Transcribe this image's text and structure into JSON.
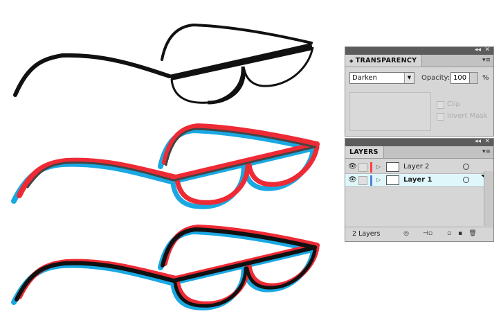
{
  "transparency_panel": {
    "title": "TRANSPARENCY",
    "blend_mode": "Darken",
    "opacity_label": "Opacity:",
    "opacity_value": "100",
    "opacity_unit": "%",
    "clip_label": "Clip",
    "invert_mask_label": "Invert Mask"
  },
  "layers_panel": {
    "title": "LAYERS",
    "layers": [
      {
        "name": "Layer 2",
        "color": "#ff4040",
        "selected": false
      },
      {
        "name": "Layer 1",
        "color": "#4f7fe0",
        "selected": true
      }
    ],
    "count_text": "2 Layers"
  },
  "colors": {
    "red": "#ee2a35",
    "cyan": "#1aa8e2",
    "black": "#111111",
    "selection": "#dff7fb"
  }
}
